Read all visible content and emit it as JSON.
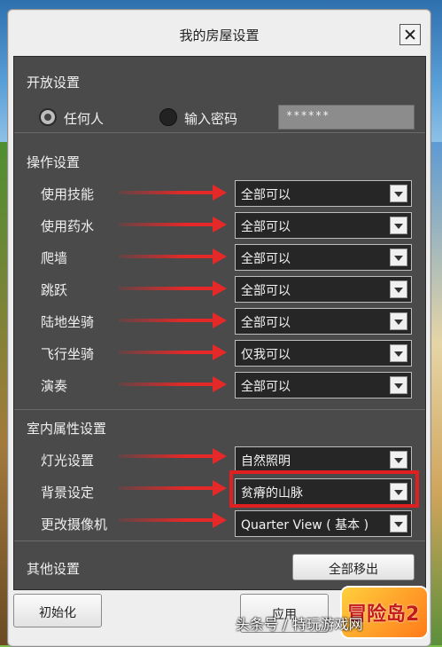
{
  "dialog": {
    "title": "我的房屋设置",
    "close_icon": "close-icon"
  },
  "open_settings": {
    "title": "开放设置",
    "options": [
      {
        "label": "任何人",
        "checked": true
      },
      {
        "label": "输入密码",
        "checked": false
      }
    ],
    "password_value": "******"
  },
  "operation_settings": {
    "title": "操作设置",
    "rows": [
      {
        "label": "使用技能",
        "value": "全部可以"
      },
      {
        "label": "使用药水",
        "value": "全部可以"
      },
      {
        "label": "爬墙",
        "value": "全部可以"
      },
      {
        "label": "跳跃",
        "value": "全部可以"
      },
      {
        "label": "陆地坐骑",
        "value": "全部可以"
      },
      {
        "label": "飞行坐骑",
        "value": "仅我可以"
      },
      {
        "label": "演奏",
        "value": "全部可以"
      }
    ]
  },
  "indoor_settings": {
    "title": "室内属性设置",
    "rows": [
      {
        "label": "灯光设置",
        "value": "自然照明"
      },
      {
        "label": "背景设定",
        "value": "贫瘠的山脉"
      },
      {
        "label": "更改摄像机",
        "value": "Quarter View ( 基本 )"
      }
    ]
  },
  "other_settings": {
    "title": "其他设置",
    "remove_all_label": "全部移出"
  },
  "footer": {
    "reset_label": "初始化",
    "apply_label": "应用"
  },
  "overlay": {
    "arrow_color": "#e52828",
    "highlight_color": "#e02020",
    "watermark": "头条号 / 特玩游戏网",
    "logo_text": "冒险岛2"
  }
}
